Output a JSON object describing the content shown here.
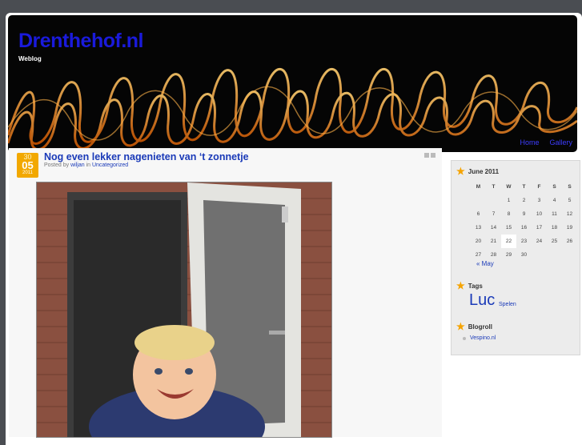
{
  "site": {
    "title": "Drenthehof.nl",
    "description": "Weblog"
  },
  "nav": {
    "items": [
      "Home",
      "Gallery"
    ]
  },
  "post": {
    "date": {
      "day": "30",
      "month": "05",
      "year": "2011"
    },
    "title": "Nog even lekker nagenieten van ‘t zonnetje",
    "meta_prefix": "Posted by",
    "author": "wiljan",
    "meta_in": "in",
    "category": "Uncategorized"
  },
  "sidebar": {
    "calendar": {
      "title": "June 2011",
      "weekdays": [
        "M",
        "T",
        "W",
        "T",
        "F",
        "S",
        "S"
      ],
      "weeks": [
        [
          "",
          "",
          "1",
          "2",
          "3",
          "4",
          "5"
        ],
        [
          "6",
          "7",
          "8",
          "9",
          "10",
          "11",
          "12"
        ],
        [
          "13",
          "14",
          "15",
          "16",
          "17",
          "18",
          "19"
        ],
        [
          "20",
          "21",
          "22",
          "23",
          "24",
          "25",
          "26"
        ],
        [
          "27",
          "28",
          "29",
          "30",
          "",
          "",
          ""
        ]
      ],
      "today": "22",
      "prev_link": "« May"
    },
    "tags": {
      "title": "Tags",
      "items": [
        "Luc",
        "Spelen"
      ]
    },
    "blogroll": {
      "title": "Blogroll",
      "items": [
        "Vespino.nl"
      ]
    }
  },
  "colors": {
    "accent": "#f2a800",
    "link": "#1a3ab8",
    "title": "#1a1adb"
  }
}
